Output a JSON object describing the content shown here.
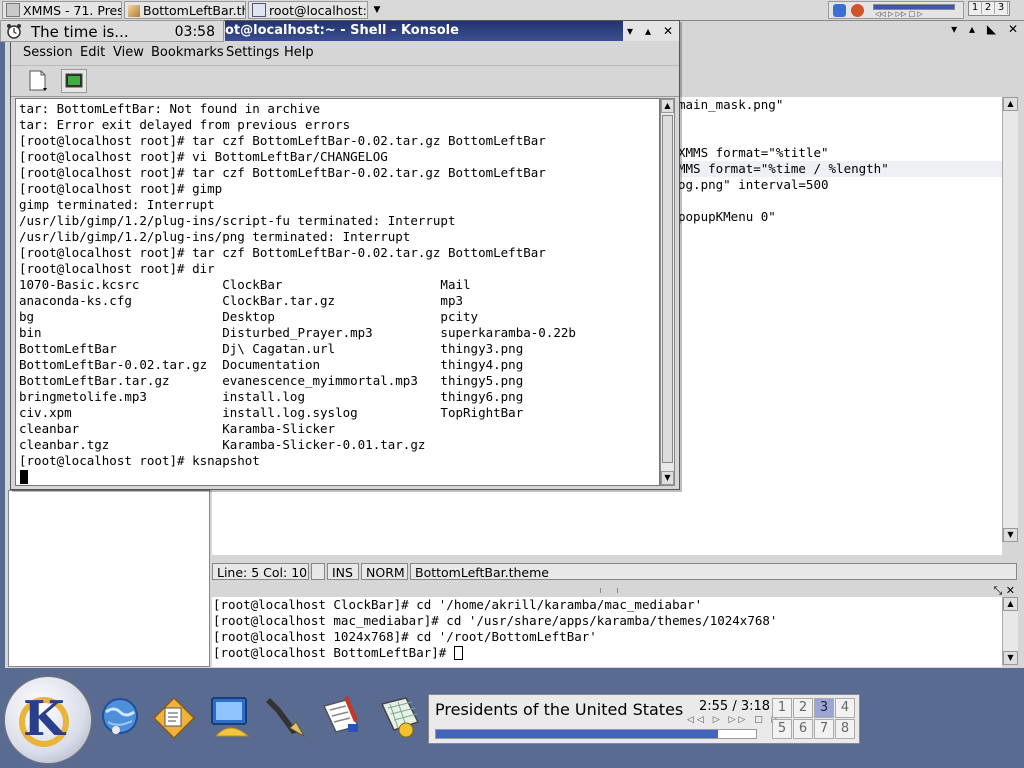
{
  "top_taskbar": {
    "tasks": [
      {
        "label": "XMMS - 71. Pres"
      },
      {
        "label": "BottomLeftBar.th"
      },
      {
        "label": "root@localhost:~"
      }
    ],
    "pager": [
      "1",
      "2",
      "3"
    ]
  },
  "clock": {
    "label": "The time is...",
    "time": "03:58"
  },
  "konsole": {
    "title": "root@localhost:~ - Shell - Konsole",
    "title_visible": "ot@localhost:~ - Shell - Konsole",
    "menu": [
      "Session",
      "Edit",
      "View",
      "Bookmarks",
      "Settings",
      "Help"
    ],
    "lines": [
      "tar: BottomLeftBar: Not found in archive",
      "tar: Error exit delayed from previous errors",
      "[root@localhost root]# tar czf BottomLeftBar-0.02.tar.gz BottomLeftBar",
      "[root@localhost root]# vi BottomLeftBar/CHANGELOG",
      "[root@localhost root]# tar czf BottomLeftBar-0.02.tar.gz BottomLeftBar",
      "[root@localhost root]# gimp",
      "gimp terminated: Interrupt",
      "/usr/lib/gimp/1.2/plug-ins/script-fu terminated: Interrupt",
      "/usr/lib/gimp/1.2/plug-ins/png terminated: Interrupt",
      "[root@localhost root]# tar czf BottomLeftBar-0.02.tar.gz BottomLeftBar",
      "[root@localhost root]# dir",
      "1070-Basic.kcsrc           ClockBar                     Mail",
      "anaconda-ks.cfg            ClockBar.tar.gz              mp3",
      "bg                         Desktop                      pcity",
      "bin                        Disturbed_Prayer.mp3         superkaramba-0.22b",
      "BottomLeftBar              Dj\\ Cagatan.url              thingy3.png",
      "BottomLeftBar-0.02.tar.gz  Documentation                thingy4.png",
      "BottomLeftBar.tar.gz       evanescence_myimmortal.mp3   thingy5.png",
      "bringmetolife.mp3          install.log                  thingy6.png",
      "civ.xpm                    install.log.syslog           TopRightBar",
      "cleanbar                   Karamba-Slicker",
      "cleanbar.tgz               Karamba-Slicker-0.01.tar.gz",
      "[root@localhost root]# ksnapshot"
    ]
  },
  "editor": {
    "lines": [
      {
        "text": "main_mask.png\"",
        "row": 0
      },
      {
        "text": "XMMS format=\"%title\"",
        "row": 3
      },
      {
        "text": "MMS format=\"%time / %length\"",
        "row": 4,
        "highlight": true
      },
      {
        "text": "og.png\" interval=500",
        "row": 5
      },
      {
        "text": "popupKMenu 0\"",
        "row": 7
      }
    ],
    "status": {
      "position": "Line: 5 Col: 10",
      "empty": "",
      "insert_mode": "INS",
      "select_mode": "NORM",
      "filename": "BottomLeftBar.theme"
    }
  },
  "embedded_terminal": {
    "lines": [
      "[root@localhost ClockBar]# cd '/home/akrill/karamba/mac_mediabar'",
      "[root@localhost mac_mediabar]# cd '/usr/share/apps/karamba/themes/1024x768'",
      "[root@localhost 1024x768]# cd '/root/BottomLeftBar'",
      "[root@localhost BottomLeftBar]# "
    ]
  },
  "media": {
    "title": "Presidents of the United States - Ca",
    "time": "2:55 / 3:18",
    "controls": "◁◁ ▷ ▷▷ □ ▷",
    "progress_fraction": 0.88
  },
  "pager": {
    "desktops": [
      "1",
      "2",
      "3",
      "4",
      "5",
      "6",
      "7",
      "8"
    ],
    "active": "3"
  },
  "colors": {
    "titlebar": "#2c3f80",
    "desktop": "#5a6b92",
    "progress": "#4163c4"
  }
}
